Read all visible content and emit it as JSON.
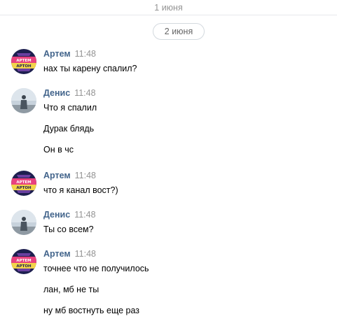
{
  "dividers": {
    "prev_date": "1 июня",
    "current_date": "2 июня"
  },
  "avatars": {
    "artem_badge_line1": "АРТЕМ",
    "artem_badge_line2": "АРТОН"
  },
  "colors": {
    "author": "#42648b",
    "time": "#939393",
    "text": "#000000",
    "artem_badge_navy": "#1d1f4f",
    "artem_badge_pink": "#e8427f",
    "artem_badge_yellow": "#f2d44a"
  },
  "messages": [
    {
      "author": "Артем",
      "time": "11:48",
      "avatar_icon": "artem-badge-icon",
      "lines": [
        "нах ты карену спалил?"
      ]
    },
    {
      "author": "Денис",
      "time": "11:48",
      "avatar_icon": "denis-photo-icon",
      "lines": [
        "Что я спалил",
        "Дурак блядь",
        "Он в чс"
      ]
    },
    {
      "author": "Артем",
      "time": "11:48",
      "avatar_icon": "artem-badge-icon",
      "lines": [
        "что я канал вост?)"
      ]
    },
    {
      "author": "Денис",
      "time": "11:48",
      "avatar_icon": "denis-photo-icon",
      "lines": [
        "Ты со всем?"
      ]
    },
    {
      "author": "Артем",
      "time": "11:48",
      "avatar_icon": "artem-badge-icon",
      "lines": [
        "точнее что не получилось",
        "лан, мб не ты",
        "ну мб востнуть еще раз"
      ]
    }
  ]
}
